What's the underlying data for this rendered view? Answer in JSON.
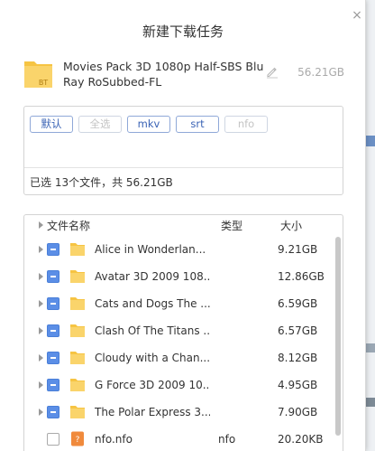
{
  "dialog": {
    "title": "新建下载任务",
    "close_label": "×"
  },
  "task": {
    "name": "Movies Pack 3D 1080p Half-SBS BluRay RoSubbed-FL",
    "size": "56.21GB",
    "icon_badge": "BT"
  },
  "filters": {
    "buttons": [
      {
        "label": "默认",
        "enabled": true
      },
      {
        "label": "全选",
        "enabled": false
      },
      {
        "label": "mkv",
        "enabled": true
      },
      {
        "label": "srt",
        "enabled": true
      },
      {
        "label": "nfo",
        "enabled": false
      }
    ],
    "summary": "已选 13个文件，共 56.21GB"
  },
  "file_list": {
    "columns": {
      "name": "文件名称",
      "type": "类型",
      "size": "大小"
    },
    "rows": [
      {
        "name": "Alice in Wonderlan...",
        "type": "",
        "size": "9.21GB",
        "kind": "folder",
        "check": "partial"
      },
      {
        "name": "Avatar 3D 2009 108...",
        "type": "",
        "size": "12.86GB",
        "kind": "folder",
        "check": "partial"
      },
      {
        "name": "Cats and Dogs The ...",
        "type": "",
        "size": "6.59GB",
        "kind": "folder",
        "check": "partial"
      },
      {
        "name": "Clash Of The Titans ...",
        "type": "",
        "size": "6.57GB",
        "kind": "folder",
        "check": "partial"
      },
      {
        "name": "Cloudy with a Chan...",
        "type": "",
        "size": "8.12GB",
        "kind": "folder",
        "check": "partial"
      },
      {
        "name": "G Force 3D 2009 10...",
        "type": "",
        "size": "4.95GB",
        "kind": "folder",
        "check": "partial"
      },
      {
        "name": "The Polar Express 3...",
        "type": "",
        "size": "7.90GB",
        "kind": "folder",
        "check": "partial"
      },
      {
        "name": "nfo.nfo",
        "type": "nfo",
        "size": "20.20KB",
        "kind": "file",
        "check": "empty"
      }
    ]
  },
  "colors": {
    "accent_blue": "#5b8ee6",
    "folder_yellow": "#f8cf5a",
    "nfo_orange": "#f08a3c"
  }
}
